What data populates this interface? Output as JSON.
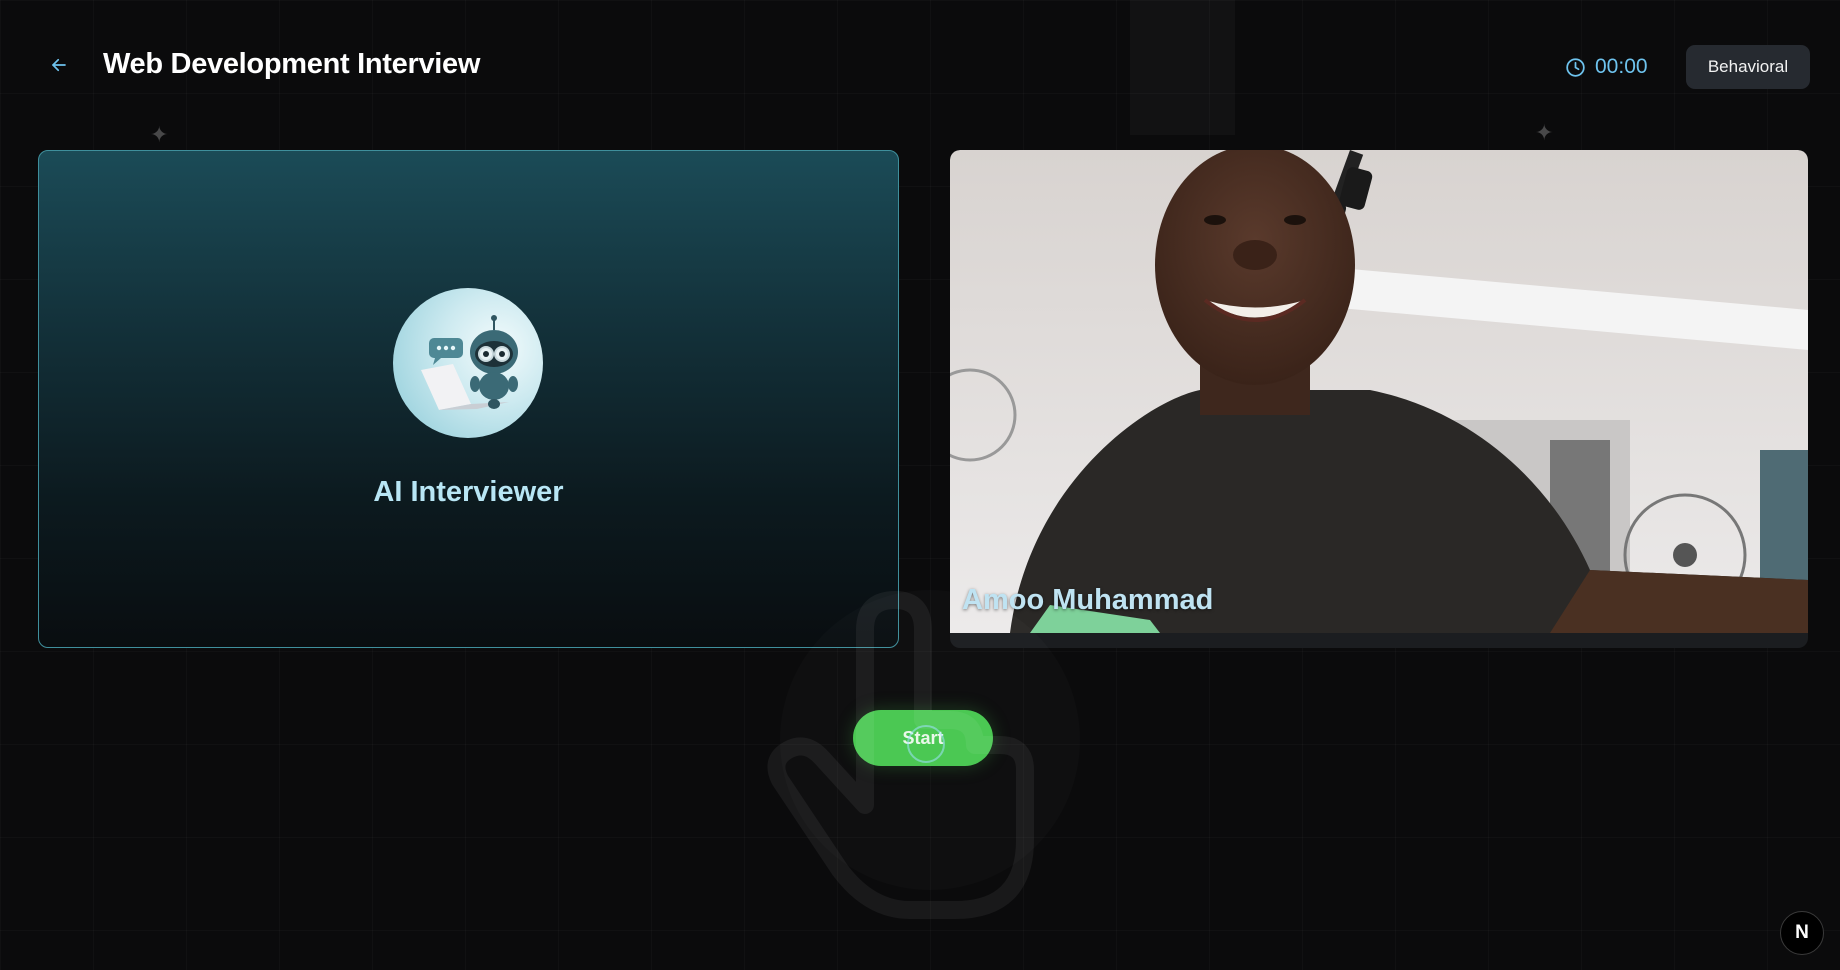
{
  "header": {
    "title": "Web Development Interview",
    "timer": "00:00",
    "interview_type": "Behavioral"
  },
  "interviewer": {
    "label": "AI Interviewer"
  },
  "candidate": {
    "name": "Amoo Muhammad"
  },
  "controls": {
    "start_label": "Start"
  },
  "dev_badge": {
    "letter": "N"
  },
  "icons": {
    "back": "arrow-left-icon",
    "timer": "clock-icon",
    "cursor": "hand-pointer-icon"
  },
  "colors": {
    "accent": "#6ec3ee",
    "start_button": "#48c750",
    "panel_border": "#3f8f9c",
    "badge_bg": "#262a30"
  }
}
